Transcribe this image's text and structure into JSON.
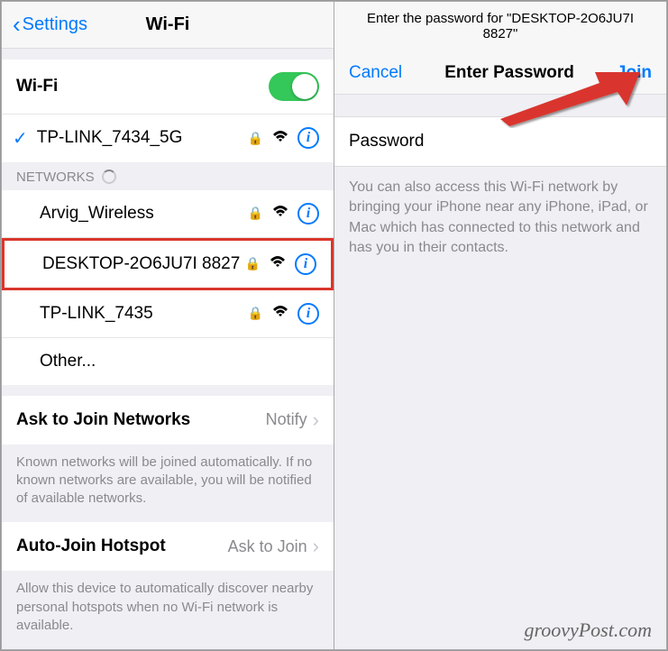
{
  "left": {
    "back_label": "Settings",
    "title": "Wi-Fi",
    "wifi_toggle_label": "Wi-Fi",
    "connected_network": "TP-LINK_7434_5G",
    "networks_header": "Networks",
    "networks": [
      {
        "name": "Arvig_Wireless"
      },
      {
        "name": "DESKTOP-2O6JU7I 8827"
      },
      {
        "name": "TP-LINK_7435"
      }
    ],
    "other_label": "Other...",
    "ask_join_label": "Ask to Join Networks",
    "ask_join_value": "Notify",
    "ask_join_footer": "Known networks will be joined automatically. If no known networks are available, you will be notified of available networks.",
    "auto_join_label": "Auto-Join Hotspot",
    "auto_join_value": "Ask to Join",
    "auto_join_footer": "Allow this device to automatically discover nearby personal hotspots when no Wi-Fi network is available."
  },
  "right": {
    "subheader": "Enter the password for \"DESKTOP-2O6JU7I 8827\"",
    "cancel_label": "Cancel",
    "title": "Enter Password",
    "join_label": "Join",
    "password_label": "Password",
    "hint": "You can also access this Wi-Fi network by bringing your iPhone near any iPhone, iPad, or Mac which has connected to this network and has you in their contacts."
  },
  "watermark": "groovyPost.com"
}
